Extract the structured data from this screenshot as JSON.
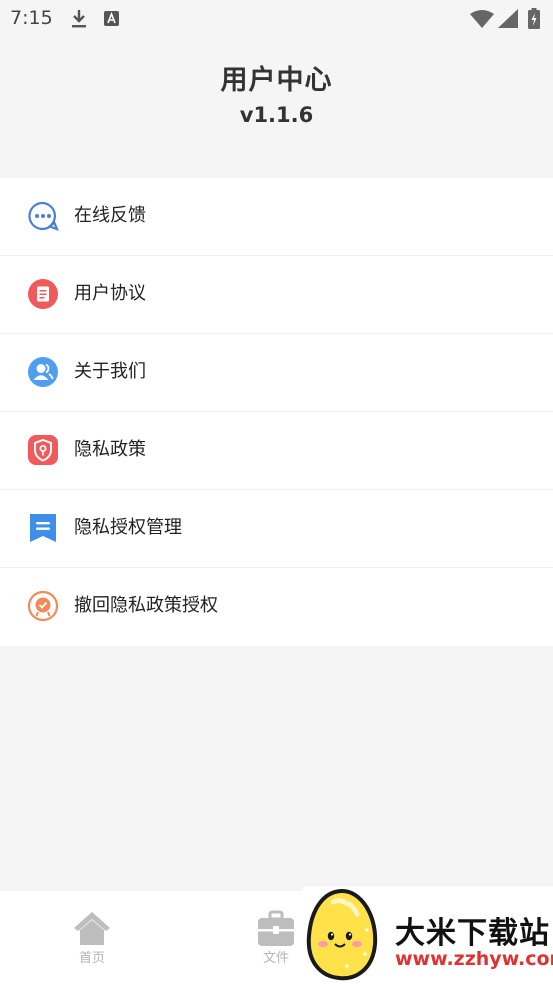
{
  "status_bar": {
    "time": "7:15"
  },
  "header": {
    "title": "用户中心",
    "version": "v1.1.6"
  },
  "menu": {
    "items": [
      {
        "label": "在线反馈",
        "icon": "chat-bubble-icon",
        "color": "#4a7fd9"
      },
      {
        "label": "用户协议",
        "icon": "document-icon",
        "color": "#f05a5a"
      },
      {
        "label": "关于我们",
        "icon": "users-icon",
        "color": "#4f9ff0"
      },
      {
        "label": "隐私政策",
        "icon": "shield-icon",
        "color": "#f05a5a"
      },
      {
        "label": "隐私授权管理",
        "icon": "bookmark-list-icon",
        "color": "#3d8fe8"
      },
      {
        "label": "撤回隐私政策授权",
        "icon": "badge-icon",
        "color": "#f08b5a"
      }
    ]
  },
  "bottom_nav": {
    "items": [
      {
        "label": "首页",
        "icon": "home-icon"
      },
      {
        "label": "文件",
        "icon": "briefcase-icon"
      }
    ]
  },
  "watermark": {
    "name": "大米下载站",
    "url": "www.zzhyw.com"
  }
}
